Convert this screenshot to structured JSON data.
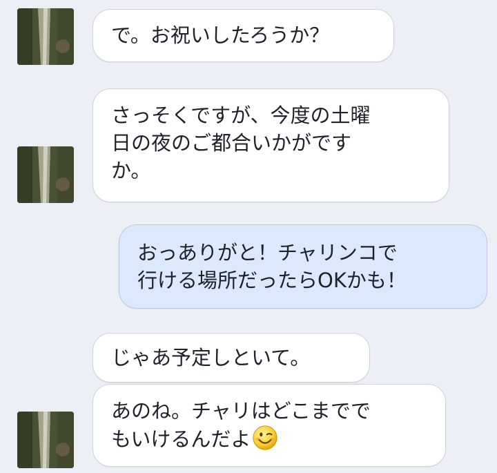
{
  "conversation": {
    "messages": [
      {
        "sender": "friend",
        "lines": [
          "で。お祝いしたろうか？"
        ]
      },
      {
        "sender": "friend",
        "lines": [
          "さっそくですが、今度の土曜",
          "日の夜のご都合いかがです",
          "か。"
        ]
      },
      {
        "sender": "me",
        "lines": [
          "おっありがと！チャリンコで",
          "行ける場所だったらOKかも！"
        ]
      },
      {
        "sender": "friend",
        "lines": [
          "じゃあ予定しといて。"
        ]
      },
      {
        "sender": "friend",
        "lines": [
          "あのね。チャリはどこまでで",
          "もいけるんだよ"
        ],
        "emoji": "wink-smiley-icon"
      }
    ]
  },
  "colors": {
    "background": "#eceff5",
    "incoming_bubble": "#ffffff",
    "outgoing_bubble": "#dce8fb",
    "text": "#1d2129"
  }
}
